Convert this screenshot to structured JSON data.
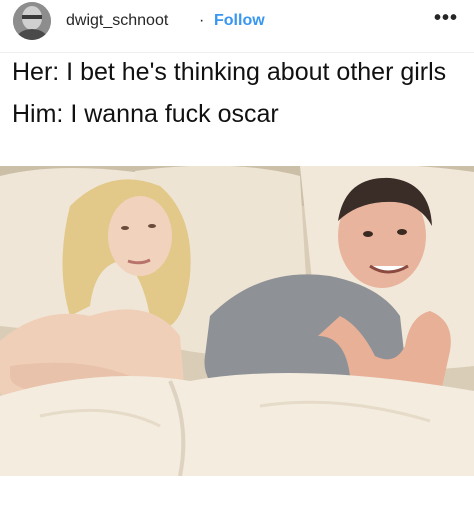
{
  "post": {
    "username": "dwigt_schnoot",
    "separator": "·",
    "follow_label": "Follow",
    "more_icon": "more-options-icon",
    "more_glyph": "•••"
  },
  "caption": {
    "line1": "Her: I bet he's thinking about other girls",
    "line2": "Him: I wanna fuck oscar"
  },
  "image": {
    "subject": "couple-in-bed-meme-photo"
  },
  "colors": {
    "follow": "#3897f0",
    "text": "#262626",
    "caption": "#111111"
  }
}
